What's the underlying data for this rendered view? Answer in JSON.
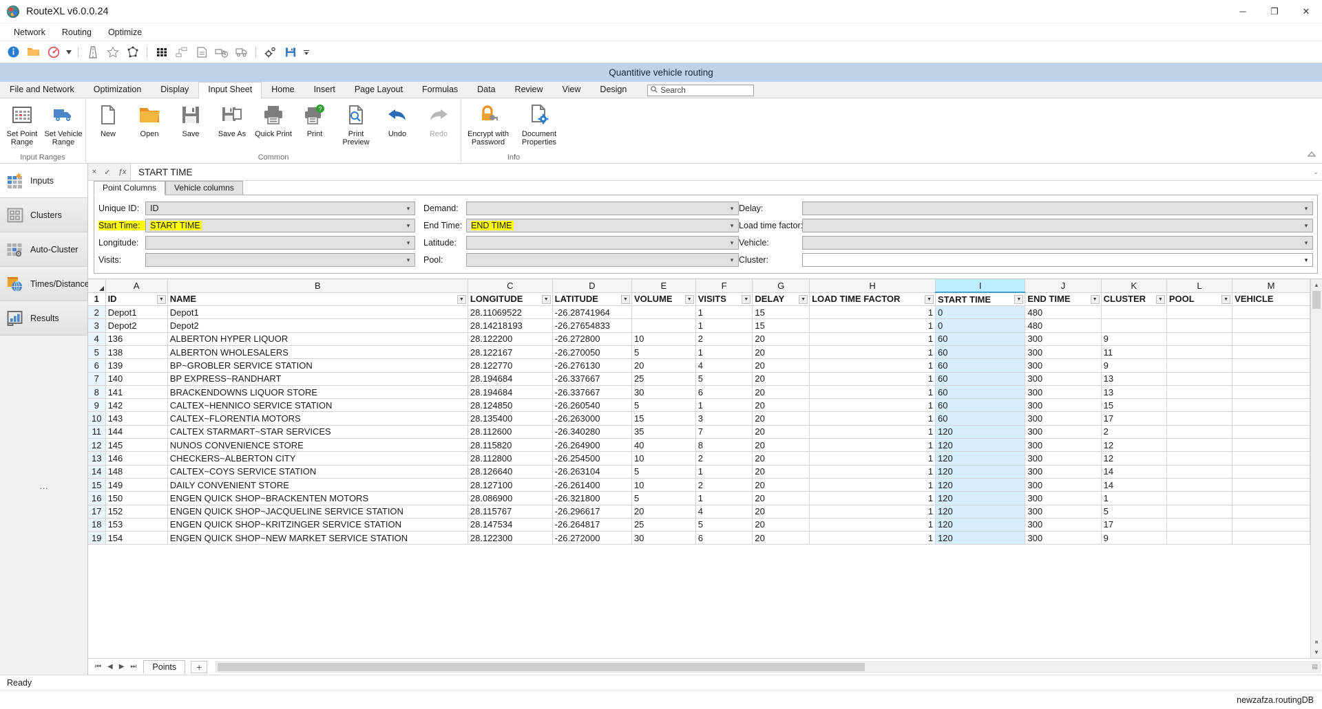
{
  "titlebar": {
    "title": "RouteXL v6.0.0.24",
    "minimize": "─",
    "maximize": "❐",
    "close": "✕"
  },
  "menubar": {
    "items": [
      "Network",
      "Routing",
      "Optimize"
    ]
  },
  "quick_toolbar": {
    "icons": [
      "info-icon",
      "open-folder-icon",
      "speedometer-icon",
      "dropdown-arrow-icon",
      "highway-icon",
      "star-icon",
      "polygon-icon",
      "matrix-icon",
      "network-nodes-icon",
      "document-list-icon",
      "truck-clock-icon",
      "truck-fleet-icon",
      "settings-gears-icon",
      "save-disk-icon",
      "more-arrow-icon"
    ]
  },
  "doc_title": "Quantitive vehicle routing",
  "ribbon": {
    "tabs": [
      "File and Network",
      "Optimization",
      "Display",
      "Input Sheet",
      "Home",
      "Insert",
      "Page Layout",
      "Formulas",
      "Data",
      "Review",
      "View",
      "Design"
    ],
    "active_tab": "Input Sheet",
    "search_placeholder": "Search",
    "groups": [
      {
        "label": "Input Ranges",
        "buttons": [
          {
            "label": "Set Point Range",
            "icon": "point-grid-icon"
          },
          {
            "label": "Set Vehicle Range",
            "icon": "truck-icon"
          }
        ]
      },
      {
        "label": "Common",
        "buttons": [
          {
            "label": "New",
            "icon": "new-document-icon"
          },
          {
            "label": "Open",
            "icon": "open-folder-icon"
          },
          {
            "label": "Save",
            "icon": "floppy-disk-icon"
          },
          {
            "label": "Save As",
            "icon": "save-as-icon"
          },
          {
            "label": "Quick Print",
            "icon": "printer-icon"
          },
          {
            "label": "Print",
            "icon": "print-help-icon"
          },
          {
            "label": "Print Preview",
            "icon": "print-preview-icon"
          },
          {
            "label": "Undo",
            "icon": "undo-arrow-icon"
          },
          {
            "label": "Redo",
            "icon": "redo-arrow-icon",
            "disabled": true
          }
        ]
      },
      {
        "label": "Info",
        "buttons": [
          {
            "label": "Encrypt with Password",
            "icon": "lock-key-icon"
          },
          {
            "label": "Document Properties",
            "icon": "document-gear-icon"
          }
        ]
      }
    ]
  },
  "sidebar": {
    "items": [
      {
        "label": "Inputs",
        "icon": "inputs-grid-icon",
        "active": true
      },
      {
        "label": "Clusters",
        "icon": "clusters-icon",
        "active": false
      },
      {
        "label": "Auto-Cluster",
        "icon": "auto-cluster-icon",
        "active": false
      },
      {
        "label": "Times/Distances",
        "icon": "times-distances-globe-icon",
        "active": false
      },
      {
        "label": "Results",
        "icon": "results-chart-icon",
        "active": false
      }
    ],
    "overflow": "…"
  },
  "formula_bar": {
    "cancel": "×",
    "accept": "✓",
    "function": "ƒx",
    "value": "START TIME",
    "expand": "⌄"
  },
  "panel": {
    "tabs": [
      {
        "label": "Point Columns",
        "active": true
      },
      {
        "label": "Vehicle columns",
        "active": false
      }
    ],
    "fields": [
      {
        "label": "Unique ID:",
        "value": "ID",
        "label_hl": false,
        "value_hl": false,
        "style": "gray"
      },
      {
        "label": "Demand:",
        "value": "",
        "label_hl": false,
        "value_hl": false,
        "style": "gray"
      },
      {
        "label": "Delay:",
        "value": "",
        "label_hl": false,
        "value_hl": false,
        "style": "gray"
      },
      {
        "label": "Start Time:",
        "value": "START TIME",
        "label_hl": true,
        "value_hl": true,
        "style": "gray"
      },
      {
        "label": "End Time:",
        "value": "END TIME",
        "label_hl": false,
        "value_hl": true,
        "style": "gray"
      },
      {
        "label": "Load time factor:",
        "value": "",
        "label_hl": false,
        "value_hl": false,
        "style": "gray"
      },
      {
        "label": "Longitude:",
        "value": "",
        "label_hl": false,
        "value_hl": false,
        "style": "gray"
      },
      {
        "label": "Latitude:",
        "value": "",
        "label_hl": false,
        "value_hl": false,
        "style": "gray"
      },
      {
        "label": "Vehicle:",
        "value": "",
        "label_hl": false,
        "value_hl": false,
        "style": "gray"
      },
      {
        "label": "Visits:",
        "value": "",
        "label_hl": false,
        "value_hl": false,
        "style": "gray"
      },
      {
        "label": "Pool:",
        "value": "",
        "label_hl": false,
        "value_hl": false,
        "style": "gray"
      },
      {
        "label": "Cluster:",
        "value": "",
        "label_hl": false,
        "value_hl": false,
        "style": "white"
      }
    ]
  },
  "sheet": {
    "column_letters": [
      "A",
      "B",
      "C",
      "D",
      "E",
      "F",
      "G",
      "H",
      "I",
      "J",
      "K",
      "L",
      "M"
    ],
    "selected_column": "I",
    "headers": [
      "ID",
      "NAME",
      "LONGITUDE",
      "LATITUDE",
      "VOLUME",
      "VISITS",
      "DELAY",
      "LOAD TIME FACTOR",
      "START TIME",
      "END TIME",
      "CLUSTER",
      "POOL",
      "VEHICLE"
    ],
    "highlighted_headers": [
      "START TIME",
      "END TIME"
    ],
    "rows": [
      {
        "n": "2",
        "cells": [
          "Depot1",
          "Depot1",
          "28.11069522",
          "-26.28741964",
          "",
          "1",
          "15",
          "1",
          "0",
          "480",
          "",
          "",
          ""
        ]
      },
      {
        "n": "3",
        "cells": [
          "Depot2",
          "Depot2",
          "28.14218193",
          "-26.27654833",
          "",
          "1",
          "15",
          "1",
          "0",
          "480",
          "",
          "",
          ""
        ]
      },
      {
        "n": "4",
        "cells": [
          "136",
          "ALBERTON HYPER LIQUOR",
          "28.122200",
          "-26.272800",
          "10",
          "2",
          "20",
          "1",
          "60",
          "300",
          "9",
          "",
          ""
        ]
      },
      {
        "n": "5",
        "cells": [
          "138",
          "ALBERTON WHOLESALERS",
          "28.122167",
          "-26.270050",
          "5",
          "1",
          "20",
          "1",
          "60",
          "300",
          "11",
          "",
          ""
        ]
      },
      {
        "n": "6",
        "cells": [
          "139",
          "BP~GROBLER SERVICE STATION",
          "28.122770",
          "-26.276130",
          "20",
          "4",
          "20",
          "1",
          "60",
          "300",
          "9",
          "",
          ""
        ]
      },
      {
        "n": "7",
        "cells": [
          "140",
          "BP EXPRESS~RANDHART",
          "28.194684",
          "-26.337667",
          "25",
          "5",
          "20",
          "1",
          "60",
          "300",
          "13",
          "",
          ""
        ]
      },
      {
        "n": "8",
        "cells": [
          "141",
          "BRACKENDOWNS LIQUOR STORE",
          "28.194684",
          "-26.337667",
          "30",
          "6",
          "20",
          "1",
          "60",
          "300",
          "13",
          "",
          ""
        ]
      },
      {
        "n": "9",
        "cells": [
          "142",
          "CALTEX~HENNICO SERVICE STATION",
          "28.124850",
          "-26.260540",
          "5",
          "1",
          "20",
          "1",
          "60",
          "300",
          "15",
          "",
          ""
        ]
      },
      {
        "n": "10",
        "cells": [
          "143",
          "CALTEX~FLORENTIA MOTORS",
          "28.135400",
          "-26.263000",
          "15",
          "3",
          "20",
          "1",
          "60",
          "300",
          "17",
          "",
          ""
        ]
      },
      {
        "n": "11",
        "cells": [
          "144",
          "CALTEX STARMART~STAR SERVICES",
          "28.112600",
          "-26.340280",
          "35",
          "7",
          "20",
          "1",
          "120",
          "300",
          "2",
          "",
          ""
        ]
      },
      {
        "n": "12",
        "cells": [
          "145",
          "NUNOS CONVENIENCE STORE",
          "28.115820",
          "-26.264900",
          "40",
          "8",
          "20",
          "1",
          "120",
          "300",
          "12",
          "",
          ""
        ]
      },
      {
        "n": "13",
        "cells": [
          "146",
          "CHECKERS~ALBERTON CITY",
          "28.112800",
          "-26.254500",
          "10",
          "2",
          "20",
          "1",
          "120",
          "300",
          "12",
          "",
          ""
        ]
      },
      {
        "n": "14",
        "cells": [
          "148",
          "CALTEX~COYS SERVICE STATION",
          "28.126640",
          "-26.263104",
          "5",
          "1",
          "20",
          "1",
          "120",
          "300",
          "14",
          "",
          ""
        ]
      },
      {
        "n": "15",
        "cells": [
          "149",
          "DAILY CONVENIENT STORE",
          "28.127100",
          "-26.261400",
          "10",
          "2",
          "20",
          "1",
          "120",
          "300",
          "14",
          "",
          ""
        ]
      },
      {
        "n": "16",
        "cells": [
          "150",
          "ENGEN QUICK SHOP~BRACKENTEN MOTORS",
          "28.086900",
          "-26.321800",
          "5",
          "1",
          "20",
          "1",
          "120",
          "300",
          "1",
          "",
          ""
        ]
      },
      {
        "n": "17",
        "cells": [
          "152",
          "ENGEN QUICK SHOP~JACQUELINE SERVICE STATION",
          "28.115767",
          "-26.296617",
          "20",
          "4",
          "20",
          "1",
          "120",
          "300",
          "5",
          "",
          ""
        ]
      },
      {
        "n": "18",
        "cells": [
          "153",
          "ENGEN QUICK SHOP~KRITZINGER SERVICE STATION",
          "28.147534",
          "-26.264817",
          "25",
          "5",
          "20",
          "1",
          "120",
          "300",
          "17",
          "",
          ""
        ]
      },
      {
        "n": "19",
        "cells": [
          "154",
          "ENGEN QUICK SHOP~NEW MARKET SERVICE STATION",
          "28.122300",
          "-26.272000",
          "30",
          "6",
          "20",
          "1",
          "120",
          "300",
          "9",
          "",
          ""
        ]
      }
    ]
  },
  "sheet_footer": {
    "first": "⏮",
    "prev": "◀",
    "next": "▶",
    "last": "⏭",
    "tab_name": "Points",
    "add_label": "+"
  },
  "statusbar": {
    "text": "Ready"
  },
  "dbbar": {
    "text": "newzafza.routingDB"
  },
  "colors": {
    "accent_blue": "#2b7cd3",
    "highlight_yellow": "#ffff00",
    "selection_blue": "#d6eefc",
    "doc_strip": "#bcd3ea",
    "orange": "#f0a22e"
  }
}
